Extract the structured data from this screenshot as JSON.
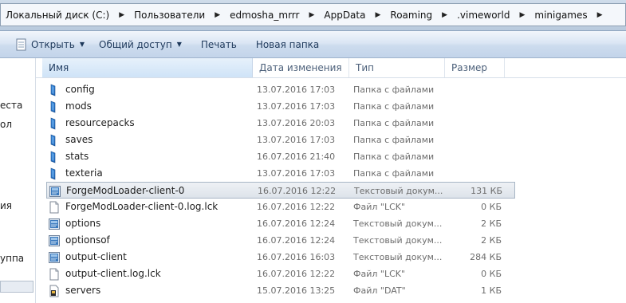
{
  "breadcrumb": {
    "items": [
      "Локальный диск (C:)",
      "Пользователи",
      "edmosha_mrrr",
      "AppData",
      "Roaming",
      ".vimeworld",
      "minigames"
    ]
  },
  "toolbar": {
    "open_label": "Открыть",
    "share_label": "Общий доступ",
    "print_label": "Печать",
    "new_folder_label": "Новая папка"
  },
  "nav_pane": {
    "labels": [
      "еста",
      "ол",
      "ия",
      "уппа"
    ]
  },
  "columns": {
    "name": "Имя",
    "date": "Дата изменения",
    "type": "Тип",
    "size": "Размер"
  },
  "files": [
    {
      "name": "config",
      "date": "13.07.2016 17:03",
      "type": "Папка с файлами",
      "size": "",
      "icon": "folder-icon"
    },
    {
      "name": "mods",
      "date": "13.07.2016 17:03",
      "type": "Папка с файлами",
      "size": "",
      "icon": "folder-icon"
    },
    {
      "name": "resourcepacks",
      "date": "13.07.2016 20:03",
      "type": "Папка с файлами",
      "size": "",
      "icon": "folder-icon"
    },
    {
      "name": "saves",
      "date": "13.07.2016 17:03",
      "type": "Папка с файлами",
      "size": "",
      "icon": "folder-icon"
    },
    {
      "name": "stats",
      "date": "16.07.2016 21:40",
      "type": "Папка с файлами",
      "size": "",
      "icon": "folder-icon"
    },
    {
      "name": "texteria",
      "date": "13.07.2016 17:03",
      "type": "Папка с файлами",
      "size": "",
      "icon": "folder-icon"
    },
    {
      "name": "ForgeModLoader-client-0",
      "date": "16.07.2016 12:22",
      "type": "Текстовый докум...",
      "size": "131 КБ",
      "icon": "text-document-icon",
      "selected": true
    },
    {
      "name": "ForgeModLoader-client-0.log.lck",
      "date": "16.07.2016 12:22",
      "type": "Файл \"LCK\"",
      "size": "0 КБ",
      "icon": "blank-file-icon"
    },
    {
      "name": "options",
      "date": "16.07.2016 12:24",
      "type": "Текстовый докум...",
      "size": "2 КБ",
      "icon": "text-document-icon"
    },
    {
      "name": "optionsof",
      "date": "16.07.2016 12:24",
      "type": "Текстовый докум...",
      "size": "2 КБ",
      "icon": "text-document-icon"
    },
    {
      "name": "output-client",
      "date": "16.07.2016 16:03",
      "type": "Текстовый докум...",
      "size": "284 КБ",
      "icon": "text-document-icon"
    },
    {
      "name": "output-client.log.lck",
      "date": "16.07.2016 12:22",
      "type": "Файл \"LCK\"",
      "size": "0 КБ",
      "icon": "blank-file-icon"
    },
    {
      "name": "servers",
      "date": "15.07.2016 13:25",
      "type": "Файл \"DAT\"",
      "size": "1 КБ",
      "icon": "dat-file-icon"
    }
  ]
}
